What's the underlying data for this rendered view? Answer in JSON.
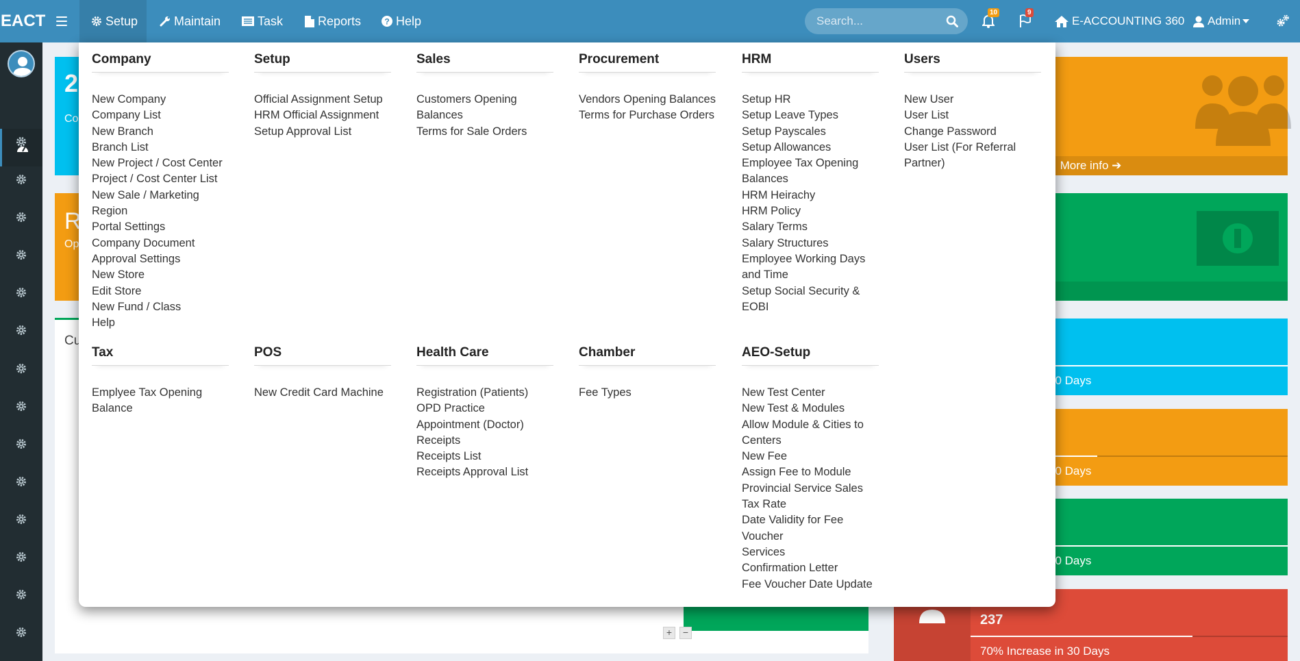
{
  "app": {
    "logo": "EACT"
  },
  "topnav": {
    "items": [
      {
        "label": "Setup",
        "icon": "gear-icon"
      },
      {
        "label": "Maintain",
        "icon": "wrench-icon"
      },
      {
        "label": "Task",
        "icon": "list-icon"
      },
      {
        "label": "Reports",
        "icon": "file-icon"
      },
      {
        "label": "Help",
        "icon": "question-circle-icon"
      }
    ],
    "search_placeholder": "Search...",
    "notifications_count": "10",
    "flags_count": "9",
    "company": "E-ACCOUNTING 360",
    "user": "Admin"
  },
  "dashboard": {
    "more_info": "More info",
    "increase_30": "30 Days",
    "bottom_value": "237",
    "bottom_label": "70% Increase in 30 Days",
    "partial_big_1": "2",
    "partial_small_1": "Co",
    "partial_big_2": "R",
    "partial_small_2": "Op",
    "partial_title_3": "Cu"
  },
  "mega_menu": {
    "row1": [
      {
        "title": "Company",
        "items": [
          "New Company",
          "Company List",
          "New Branch",
          "Branch List",
          "New Project / Cost Center",
          "Project / Cost Center List",
          "New Sale / Marketing",
          "Region",
          "Portal Settings",
          "Company Document",
          "Approval Settings",
          "New Store",
          "Edit Store",
          "New Fund / Class",
          "Help"
        ]
      },
      {
        "title": "Setup",
        "items": [
          "Official Assignment Setup",
          "HRM Official Assignment",
          "Setup Approval List"
        ]
      },
      {
        "title": "Sales",
        "items": [
          "Customers Opening Balances",
          "Terms for Sale Orders"
        ]
      },
      {
        "title": "Procurement",
        "items": [
          "Vendors Opening Balances",
          "Terms for Purchase Orders"
        ]
      },
      {
        "title": "HRM",
        "items": [
          "Setup HR",
          "Setup Leave Types",
          "Setup Payscales",
          "Setup Allowances",
          "Employee Tax Opening Balances",
          "HRM Heirachy",
          "HRM Policy",
          "Salary Terms",
          "Salary Structures",
          "Employee Working Days and Time",
          "Setup Social Security & EOBI"
        ]
      },
      {
        "title": "Users",
        "items": [
          "New User",
          "User List",
          "Change Password",
          "User List (For Referral Partner)"
        ]
      }
    ],
    "row2": [
      {
        "title": "Tax",
        "items": [
          "Emplyee Tax Opening Balance"
        ]
      },
      {
        "title": "POS",
        "items": [
          "New Credit Card Machine"
        ]
      },
      {
        "title": "Health Care",
        "items": [
          "Registration (Patients)",
          "OPD Practice",
          "Appointment (Doctor)",
          "Receipts",
          "Receipts List",
          "Receipts Approval List"
        ]
      },
      {
        "title": "Chamber",
        "items": [
          "Fee Types"
        ]
      },
      {
        "title": "AEO-Setup",
        "items": [
          "New Test Center",
          "New Test & Modules",
          "Allow Module & Cities to Centers",
          "New Fee",
          "Assign Fee to Module",
          "Provincial Service Sales Tax Rate",
          "Date Validity for Fee Voucher",
          "Services",
          "Confirmation Letter",
          "Fee Voucher Date Update"
        ]
      }
    ]
  }
}
